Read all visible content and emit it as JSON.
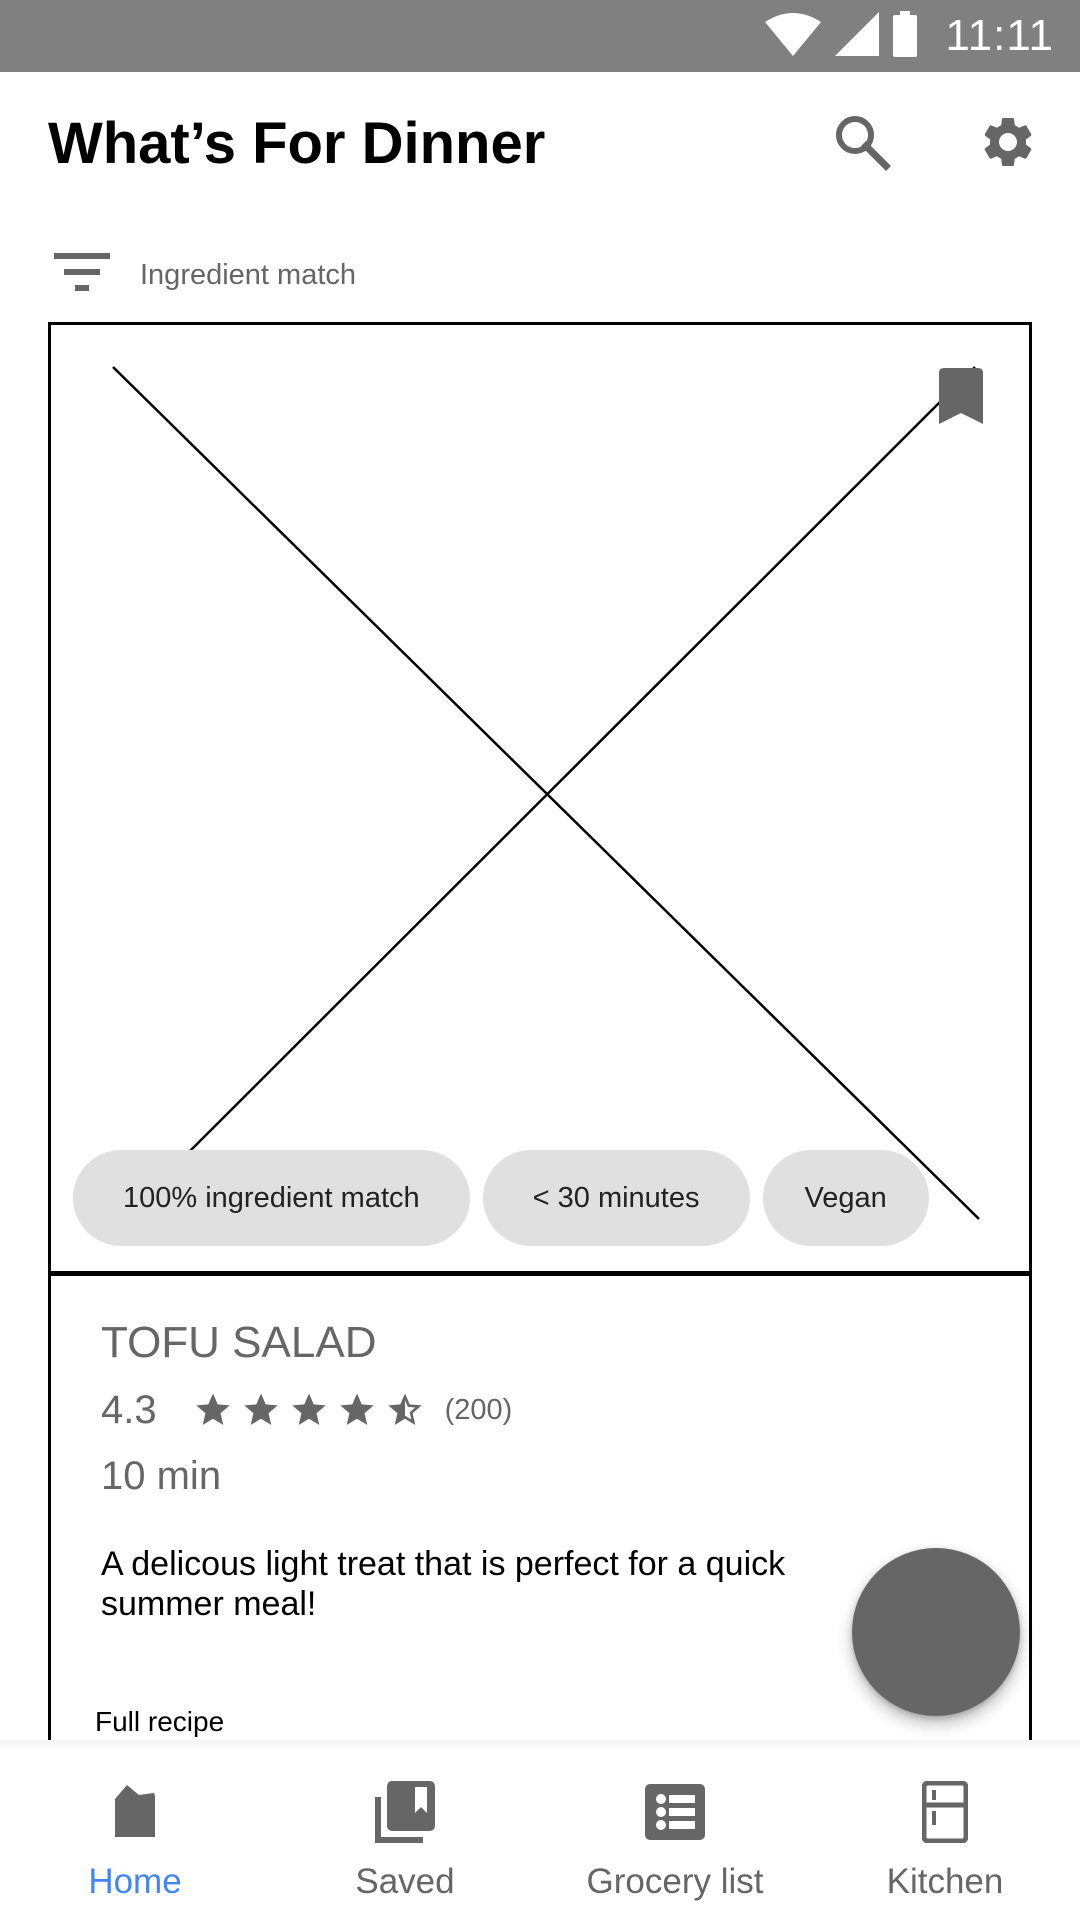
{
  "status_bar": {
    "time": "11:11",
    "icons": [
      "wifi-icon",
      "cellular-signal-icon",
      "battery-icon"
    ]
  },
  "app_bar": {
    "title": "What’s For Dinner",
    "actions": [
      {
        "name": "search",
        "icon": "search-icon"
      },
      {
        "name": "settings",
        "icon": "gear-icon"
      }
    ]
  },
  "filter": {
    "icon": "filter-icon",
    "label": "Ingredient match"
  },
  "recipe_card": {
    "image_placeholder": "image-placeholder",
    "bookmark_icon": "bookmark-icon",
    "chips": [
      {
        "label": "100% ingredient match"
      },
      {
        "label": "< 30 minutes"
      },
      {
        "label": "Vegan"
      }
    ],
    "title": "TOFU SALAD",
    "rating": {
      "value": "4.3",
      "stars_filled": 4,
      "stars_half": 1,
      "stars_total": 5,
      "count": "(200)"
    },
    "duration": "10 min",
    "description": "A delicous light treat that is perfect for a quick summer meal!",
    "link_label": "Full recipe"
  },
  "fab": {
    "icon": "fab"
  },
  "colors": {
    "status_bar": "#808080",
    "icon_gray": "#666666",
    "chip_bg": "#e0e0e0",
    "active_nav": "#4285f4"
  },
  "bottom_nav": {
    "items": [
      {
        "label": "Home",
        "icon": "home-icon",
        "active": true
      },
      {
        "label": "Saved",
        "icon": "saved-collection-icon",
        "active": false
      },
      {
        "label": "Grocery list",
        "icon": "list-icon",
        "active": false
      },
      {
        "label": "Kitchen",
        "icon": "fridge-icon",
        "active": false
      }
    ]
  }
}
